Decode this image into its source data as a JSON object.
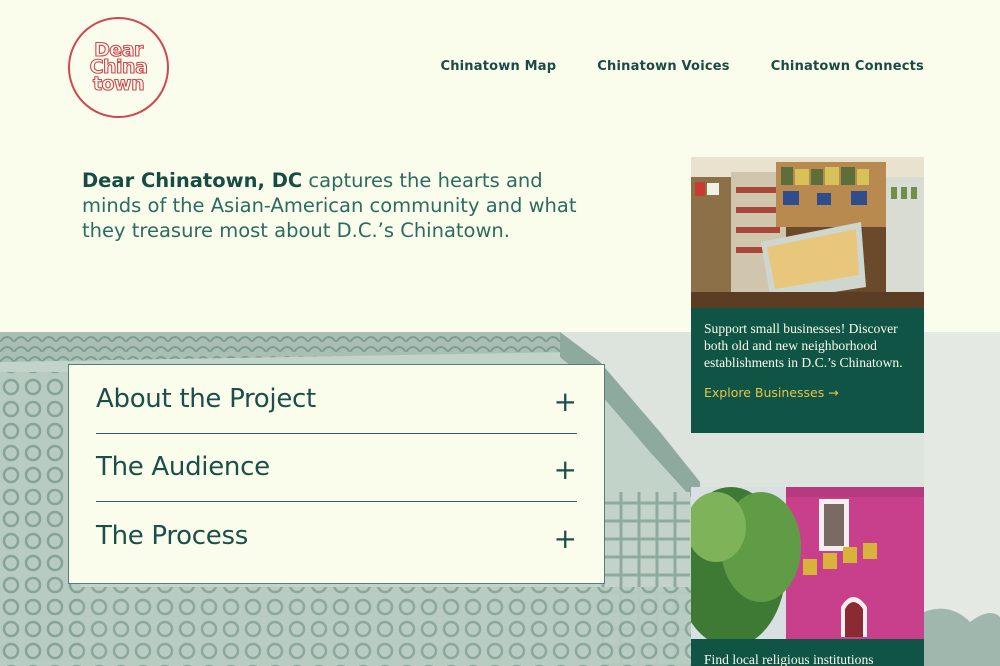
{
  "logo": {
    "lines": [
      "Dear",
      "China",
      "town"
    ]
  },
  "nav": {
    "items": [
      {
        "label": "Chinatown Map"
      },
      {
        "label": "Chinatown Voices"
      },
      {
        "label": "Chinatown Connects"
      }
    ]
  },
  "intro": {
    "bold": "Dear Chinatown, DC",
    "rest": " captures the hearts and minds of the Asian-American community and what they treasure most about D.C.’s Chinatown."
  },
  "accordion": {
    "items": [
      {
        "title": "About the Project",
        "icon": "plus-icon",
        "symbol": "+"
      },
      {
        "title": "The Audience",
        "icon": "plus-icon",
        "symbol": "+"
      },
      {
        "title": "The Process",
        "icon": "plus-icon",
        "symbol": "+"
      }
    ]
  },
  "cards": [
    {
      "text": "Support small businesses! Discover both old and new neighborhood establishments in D.C.’s Chinatown.",
      "link": "Explore Businesses →"
    },
    {
      "text": "Find local religious institutions"
    }
  ],
  "colors": {
    "background": "#fbfdec",
    "brand_green": "#0f5445",
    "logo_red": "#cf4750",
    "link_gold": "#e8c34a",
    "text_teal": "#1c4f4a"
  }
}
